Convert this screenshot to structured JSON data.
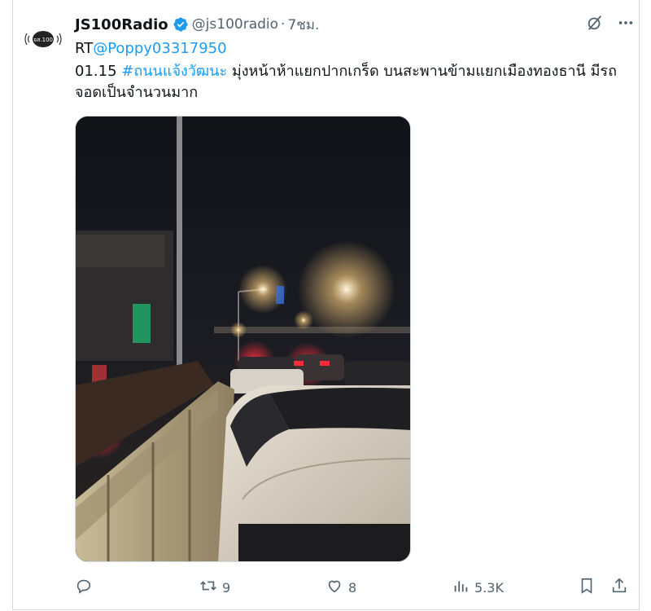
{
  "tweet": {
    "display_name": "JS100Radio",
    "handle": "@js100radio",
    "separator": "·",
    "time": "7ชม.",
    "retweet_prefix": "RT",
    "retweet_mention": "@Poppy03317950",
    "line2_time": "01.15 ",
    "hashtag": "#ถนนแจ้งวัฒนะ",
    "line2_rest": " มุ่งหน้าห้าแยกปากเกร็ด บนสะพานข้ามแยกเมืองทองธานี มีรถ",
    "line3": "จอดเป็นจำนวนมาก"
  },
  "avatar": {
    "logo_text": "จส.100"
  },
  "media": {
    "description": "night traffic jam on flyover"
  },
  "actions": {
    "retweets": "9",
    "likes": "8",
    "views": "5.3K"
  },
  "colors": {
    "accent": "#1d9bf0",
    "muted": "#536471",
    "text": "#0f1419",
    "border": "#cfd9de"
  },
  "icons": [
    "verified-badge-icon",
    "grok-icon",
    "more-icon",
    "reply-icon",
    "retweet-icon",
    "like-icon",
    "views-icon",
    "bookmark-icon",
    "share-icon"
  ]
}
